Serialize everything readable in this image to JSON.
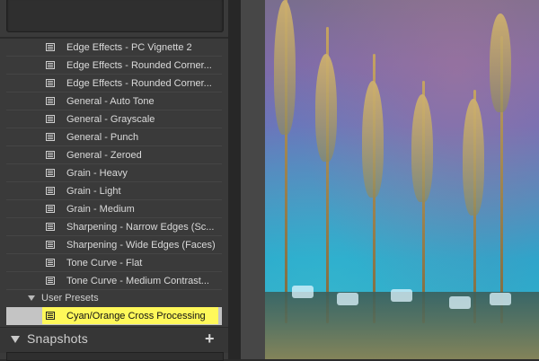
{
  "left_panel": {
    "presets": [
      {
        "label": "Edge Effects - PC Vignette 2"
      },
      {
        "label": "Edge Effects - Rounded Corner..."
      },
      {
        "label": "Edge Effects - Rounded Corner..."
      },
      {
        "label": "General - Auto Tone"
      },
      {
        "label": "General - Grayscale"
      },
      {
        "label": "General - Punch"
      },
      {
        "label": "General - Zeroed"
      },
      {
        "label": "Grain - Heavy"
      },
      {
        "label": "Grain - Light"
      },
      {
        "label": "Grain - Medium"
      },
      {
        "label": "Sharpening - Narrow Edges (Sc..."
      },
      {
        "label": "Sharpening - Wide Edges (Faces)"
      },
      {
        "label": "Tone Curve - Flat"
      },
      {
        "label": "Tone Curve - Medium Contrast..."
      }
    ],
    "user_presets_folder": {
      "label": "User Presets",
      "expanded": true
    },
    "selected_preset": {
      "label": "Cyan/Orange Cross Processing",
      "highlight_color": "#fff85a"
    },
    "snapshots": {
      "label": "Snapshots",
      "add_label": "+"
    }
  },
  "icons": {
    "preset": "preset-icon",
    "folder_toggle": "triangle-down-icon",
    "section_toggle": "triangle-down-icon",
    "add": "plus-icon"
  },
  "colors": {
    "panel_bg": "#3a3a3a",
    "text": "#dadada",
    "selected_row_bg": "#c4c4c4",
    "highlight": "#fff85a"
  }
}
